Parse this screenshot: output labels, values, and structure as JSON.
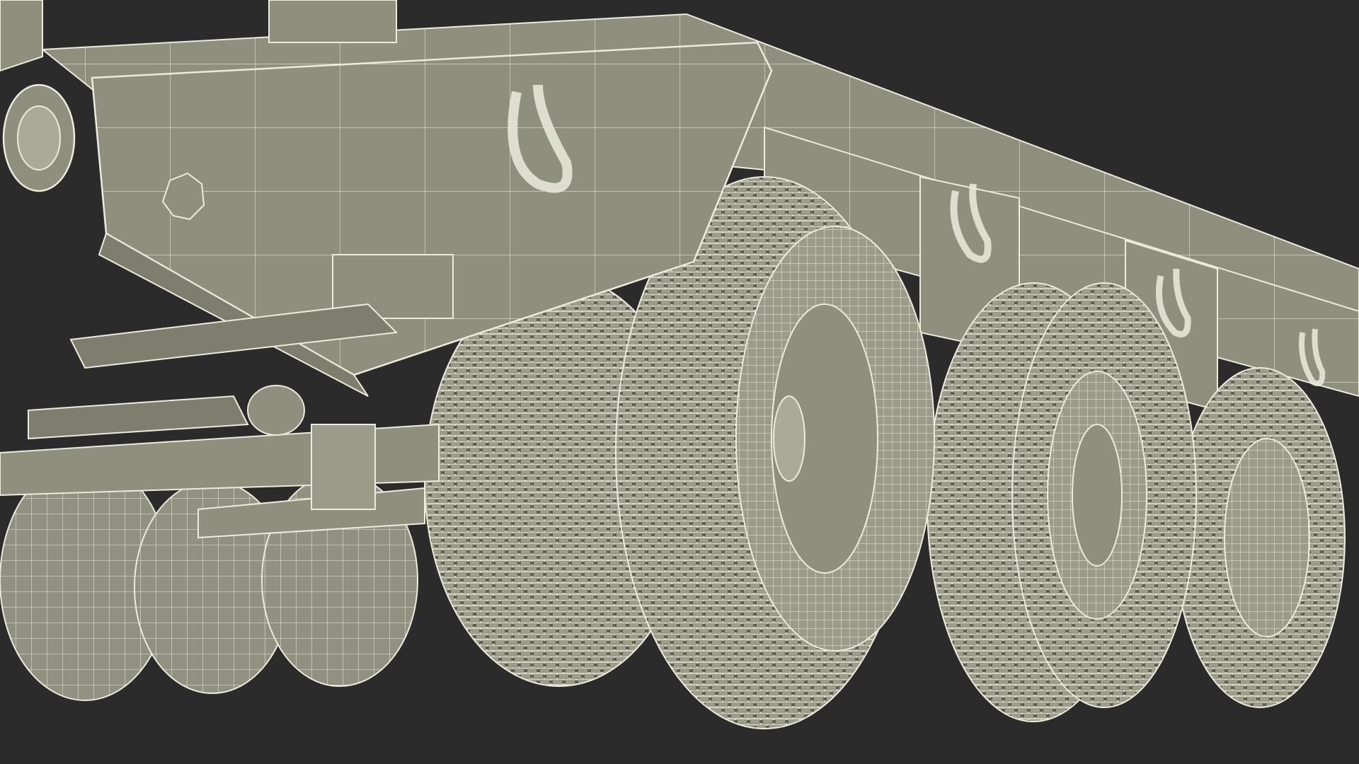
{
  "scene": {
    "subject": "trailer-undercarriage-wireframe",
    "colors": {
      "background": "#2b2b2b",
      "body": "#8e8f7d",
      "body_light": "#a9aa97",
      "body_dark": "#6f705f",
      "wire": "#ecebdc",
      "tire": "#9b9c89",
      "tire_dark": "#77786a"
    }
  }
}
